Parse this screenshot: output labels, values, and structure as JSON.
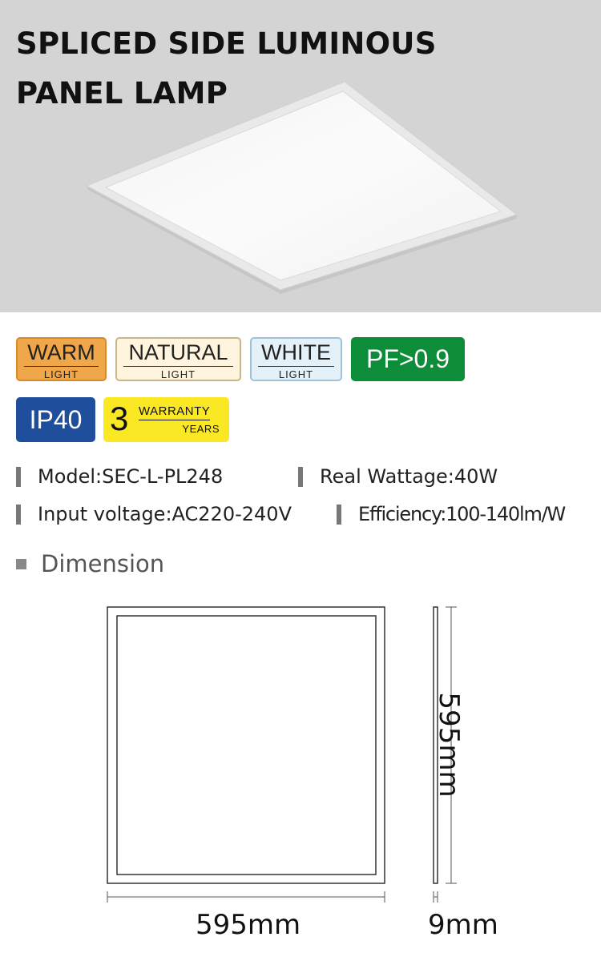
{
  "hero": {
    "title_line1": "SPLICED SIDE LUMINOUS",
    "title_line2": "PANEL LAMP",
    "background": "#d4d4d4"
  },
  "badges": {
    "warm": {
      "main": "WARM",
      "sub": "LIGHT",
      "color": "#efa74a"
    },
    "natural": {
      "main": "NATURAL",
      "sub": "LIGHT",
      "color": "#fff5df"
    },
    "white": {
      "main": "WHITE",
      "sub": "LIGHT",
      "color": "#e4f1f8"
    },
    "pf": {
      "main": "PF>0.9",
      "color": "#0d8d3a"
    },
    "ip": {
      "main": "IP40",
      "color": "#1f4f9c"
    },
    "warranty": {
      "number": "3",
      "line1": "WARRANTY",
      "line2": "YEARS",
      "color": "#fbe824"
    }
  },
  "specs": {
    "model": "Model:SEC-L-PL248",
    "wattage": "Real Wattage:40W",
    "voltage": "Input voltage:AC220-240V",
    "efficiency": "Efficiency:100-140lm/W"
  },
  "dimension": {
    "heading": "Dimension",
    "width_label": "595mm",
    "height_label": "595mm",
    "depth_label": "9mm"
  }
}
